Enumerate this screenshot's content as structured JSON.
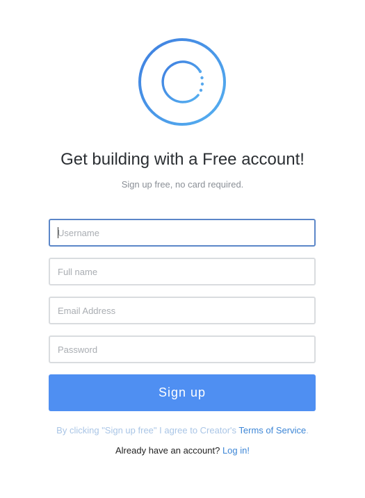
{
  "header": {
    "title": "Get building with a Free account!",
    "subtitle": "Sign up free, no card required."
  },
  "form": {
    "username_placeholder": "Username",
    "fullname_placeholder": "Full name",
    "email_placeholder": "Email Address",
    "password_placeholder": "Password",
    "signup_label": "Sign up"
  },
  "footer": {
    "terms_prefix": "By clicking \"Sign up free\" I agree to Creator's ",
    "terms_link": "Terms of Service",
    "terms_suffix": ".",
    "login_prefix": "Already have an account? ",
    "login_link": "Log in!"
  },
  "colors": {
    "accent": "#4f8ff2",
    "link": "#3d86d6",
    "focus_border": "#5b86c8"
  },
  "icons": {
    "logo": "creator-logo-icon"
  }
}
